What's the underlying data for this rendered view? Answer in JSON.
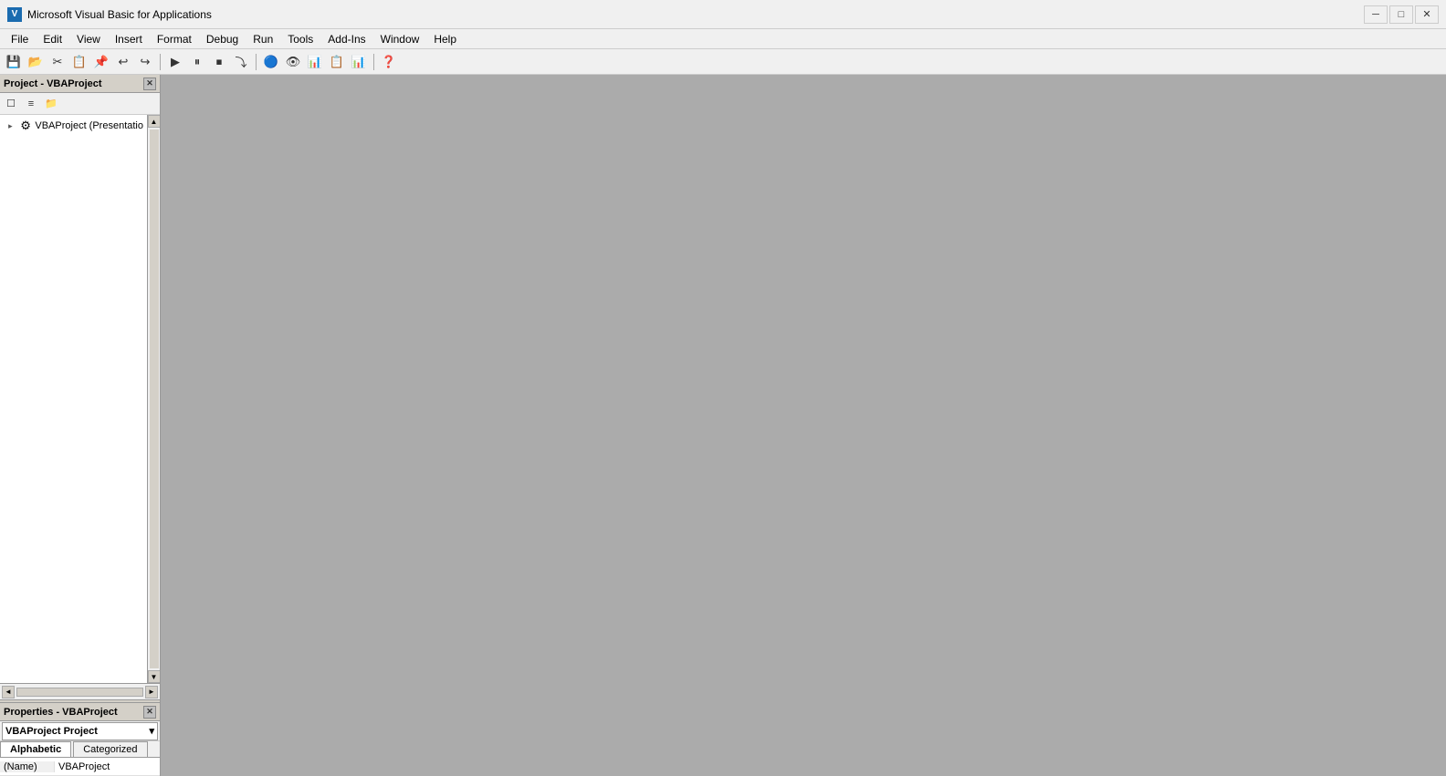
{
  "titleBar": {
    "icon": "VBA",
    "title": "Microsoft Visual Basic for Applications",
    "minimizeLabel": "─",
    "maximizeLabel": "□",
    "closeLabel": "✕"
  },
  "menuBar": {
    "items": [
      "File",
      "Edit",
      "View",
      "Insert",
      "Format",
      "Debug",
      "Run",
      "Tools",
      "Add-Ins",
      "Window",
      "Help"
    ]
  },
  "toolbar": {
    "buttons": [
      {
        "name": "save",
        "icon": "💾"
      },
      {
        "name": "open",
        "icon": "📂"
      },
      {
        "name": "cut",
        "icon": "✂"
      },
      {
        "name": "copy",
        "icon": "📋"
      },
      {
        "name": "paste",
        "icon": "📌"
      },
      {
        "name": "undo",
        "icon": "↩"
      },
      {
        "name": "redo",
        "icon": "↪"
      },
      {
        "name": "run",
        "icon": "▶"
      },
      {
        "name": "pause",
        "icon": "⏸"
      },
      {
        "name": "stop",
        "icon": "⏹"
      },
      {
        "name": "step",
        "icon": "⤵"
      },
      {
        "name": "bp",
        "icon": "🔵"
      },
      {
        "name": "watch",
        "icon": "👁"
      },
      {
        "name": "locals",
        "icon": "📊"
      },
      {
        "name": "call-stack",
        "icon": "📋"
      },
      {
        "name": "help",
        "icon": "❓"
      }
    ]
  },
  "projectPanel": {
    "title": "Project - VBAProject",
    "closeLabel": "✕",
    "treeItems": [
      {
        "label": "VBAProject (Presentatio",
        "icon": "⚙",
        "indent": 0,
        "toggle": "▸"
      }
    ]
  },
  "propertiesPanel": {
    "title": "Properties - VBAProject",
    "closeLabel": "✕",
    "dropdown": {
      "value": "VBAProject  Project"
    },
    "tabs": [
      {
        "label": "Alphabetic",
        "active": true
      },
      {
        "label": "Categorized",
        "active": false
      }
    ],
    "rows": [
      {
        "name": "(Name)",
        "value": "VBAProject"
      }
    ]
  }
}
